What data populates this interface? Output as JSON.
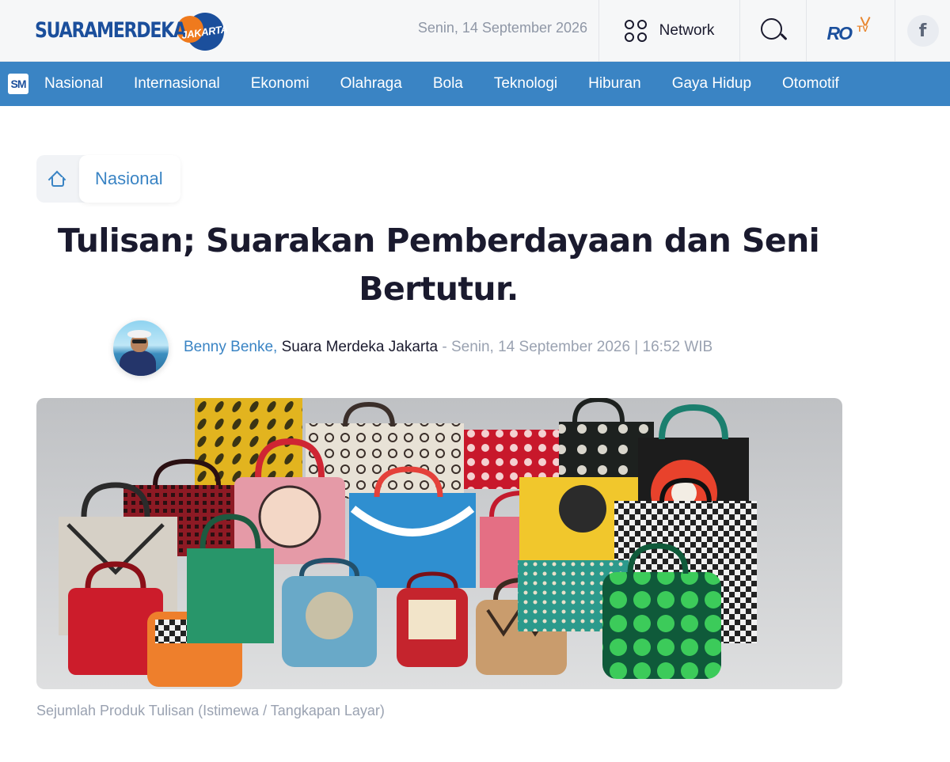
{
  "header": {
    "logo_main": "SUARAMERDEKA",
    "logo_sub": "JAKARTA",
    "date": "Senin, 14 September 2026",
    "network_label": "Network",
    "rotv_main": "RO",
    "rotv_sub": "TV",
    "facebook_glyph": "f"
  },
  "nav": {
    "logo_text": "SM",
    "items": [
      "Nasional",
      "Internasional",
      "Ekonomi",
      "Olahraga",
      "Bola",
      "Teknologi",
      "Hiburan",
      "Gaya Hidup",
      "Otomotif"
    ]
  },
  "breadcrumb": {
    "items": [
      "Nasional"
    ]
  },
  "article": {
    "title": "Tulisan; Suarakan Pemberdayaan dan Seni Bertutur.",
    "author": "Benny Benke,",
    "publication": " Suara Merdeka Jakarta",
    "date_line": " - Senin, 14 September 2026 | 16:52 WIB",
    "image_caption": "Sejumlah Produk Tulisan (Istimewa / Tangkapan Layar)"
  },
  "colors": {
    "brand_blue": "#1b4f9c",
    "nav_blue": "#3a84c4",
    "brand_orange": "#ef7a1d"
  },
  "icons": [
    "network-icon",
    "search-icon",
    "rotv-logo",
    "facebook-icon",
    "home-icon"
  ]
}
